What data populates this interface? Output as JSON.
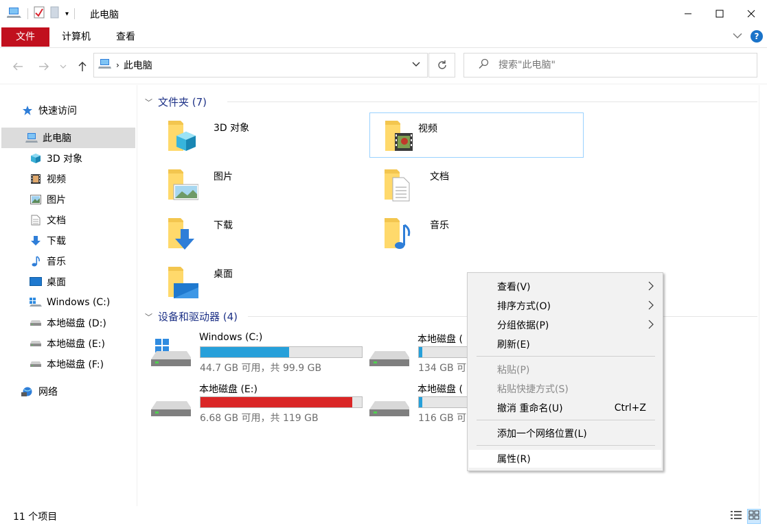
{
  "window": {
    "title": "此电脑",
    "colors": {
      "accent": "#c1101e",
      "selection": "#cce8ff",
      "bar_blue": "#26a0da",
      "bar_red": "#da2626"
    }
  },
  "ribbon": {
    "tabs": [
      "文件",
      "计算机",
      "查看"
    ]
  },
  "address": {
    "crumb": "此电脑"
  },
  "search": {
    "placeholder": "搜索\"此电脑\""
  },
  "sidebar": {
    "quick_access": "快速访问",
    "this_pc": "此电脑",
    "items": [
      "3D 对象",
      "视频",
      "图片",
      "文档",
      "下载",
      "音乐",
      "桌面",
      "Windows (C:)",
      "本地磁盘 (D:)",
      "本地磁盘 (E:)",
      "本地磁盘 (F:)"
    ],
    "network": "网络"
  },
  "folders": {
    "header": "文件夹 (7)",
    "items": [
      "3D 对象",
      "视频",
      "图片",
      "文档",
      "下载",
      "音乐",
      "桌面"
    ]
  },
  "drives": {
    "header": "设备和驱动器 (4)",
    "items": [
      {
        "name": "Windows (C:)",
        "info": "44.7 GB 可用，共 99.9 GB",
        "used_percent": 55
      },
      {
        "name": "本地磁盘 (",
        "info": "134 GB 可",
        "used_percent": 2
      },
      {
        "name": "本地磁盘 (E:)",
        "info": "6.68 GB 可用，共 119 GB",
        "used_percent": 94
      },
      {
        "name": "本地磁盘 (",
        "info": "116 GB 可",
        "used_percent": 2
      }
    ]
  },
  "context_menu": {
    "view": "查看(V)",
    "sort": "排序方式(O)",
    "group": "分组依据(P)",
    "refresh": "刷新(E)",
    "paste": "粘贴(P)",
    "paste_shortcut": "粘贴快捷方式(S)",
    "undo": "撤消 重命名(U)",
    "undo_shortcut": "Ctrl+Z",
    "add_network": "添加一个网络位置(L)",
    "properties": "属性(R)"
  },
  "status": {
    "count": "11 个项目"
  }
}
